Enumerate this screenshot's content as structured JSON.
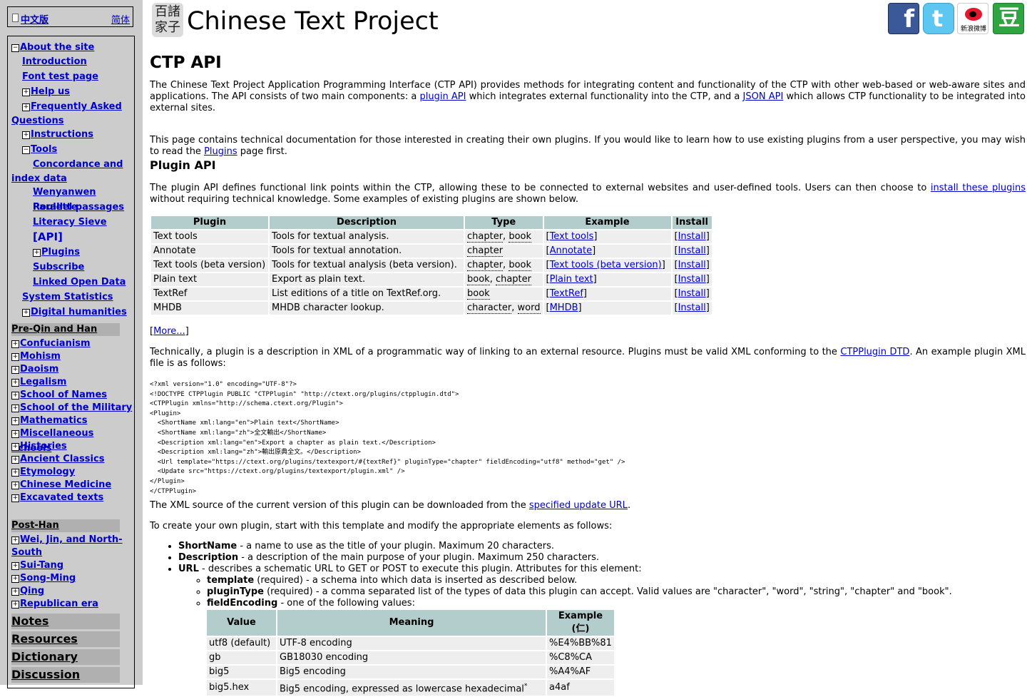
{
  "sidebar": {
    "lang_zh": "中文版",
    "lang_simp": "简体",
    "nav": [
      {
        "label": "About the site",
        "toggle": "−"
      },
      {
        "label": "Introduction"
      },
      {
        "label": "Font test page"
      },
      {
        "label": "Help us",
        "toggle": "+"
      },
      {
        "label": "Frequently Asked Questions",
        "toggle": "+",
        "line1": "Frequently Asked",
        "line2": "Questions"
      },
      {
        "label": "Instructions",
        "toggle": "+"
      },
      {
        "label": "Tools",
        "toggle": "−"
      },
      {
        "label": "Concordance and index data",
        "line1": "Concordance and",
        "line2": "index data"
      },
      {
        "label": "Wenyanwen Roulette"
      },
      {
        "label": "Parallel passages"
      },
      {
        "label": "Literacy Sieve"
      },
      {
        "label": "[API]"
      },
      {
        "label": "Plugins",
        "toggle": "+"
      },
      {
        "label": "Subscribe"
      },
      {
        "label": "Linked Open Data"
      },
      {
        "label": "System Statistics"
      },
      {
        "label": "Digital humanities",
        "toggle": "+"
      }
    ],
    "preqin_title": "Pre-Qin and Han",
    "preqin": [
      "Confucianism",
      "Mohism",
      "Daoism",
      "Legalism",
      "School of Names",
      "School of the Military",
      "Mathematics",
      "Miscellaneous Schools",
      "Histories",
      "Ancient Classics",
      "Etymology",
      "Chinese Medicine",
      "Excavated texts"
    ],
    "posthan_title": "Post-Han",
    "posthan": [
      {
        "label": "Wei, Jin, and North-South",
        "line1": "Wei, Jin, and North-",
        "line2": "South"
      },
      {
        "label": "Sui-Tang"
      },
      {
        "label": "Song-Ming"
      },
      {
        "label": "Qing"
      },
      {
        "label": "Republican era"
      }
    ],
    "big_links": [
      "Notes",
      "Resources",
      "Dictionary",
      "Discussion"
    ]
  },
  "header": {
    "logo_chars": [
      "百諸",
      "家子"
    ],
    "title": "Chinese Text Project",
    "social": {
      "facebook": "f",
      "twitter": "t",
      "weibo_caption": "新浪微博",
      "douban": "豆"
    }
  },
  "main": {
    "title": "CTP API",
    "intro1_a": "The Chinese Text Project Application Programming Interface (CTP API) provides methods for integrating content and functionality of the CTP with other web-based or web-aware sites and applications. The API consists of two main components: a ",
    "intro1_link1": "plugin API",
    "intro1_b": " which integrates external functionality into the CTP, and a ",
    "intro1_link2": "JSON API",
    "intro1_c": " which allows CTP functionality to be integrated into external sites.",
    "intro2_a": "This page contains technical documentation for those interested in creating their own plugins. If you would like to learn how to use existing plugins from a user perspective, you may wish to read the ",
    "intro2_link": "Plugins",
    "intro2_b": " page first.",
    "plugin_heading": "Plugin API",
    "plugin_intro_a": "The plugin API defines functional link points within the CTP, allowing these to be connected to external websites and user-defined tools. Users can then choose to ",
    "plugin_intro_link": "install these plugins",
    "plugin_intro_b": " without requiring technical knowledge. Some examples of existing plugins are shown below.",
    "plugin_table": {
      "headers": [
        "Plugin",
        "Description",
        "Type",
        "Example",
        "Install"
      ],
      "rows": [
        {
          "plugin": "Text tools",
          "description": "Tools for textual analysis.",
          "types": [
            "chapter",
            "book"
          ],
          "example": "Text tools",
          "install": "Install"
        },
        {
          "plugin": "Annotate",
          "description": "Tools for textual annotation.",
          "types": [
            "chapter"
          ],
          "example": "Annotate",
          "install": "Install"
        },
        {
          "plugin": "Text tools (beta version)",
          "description": "Tools for textual analysis (beta version).",
          "types": [
            "chapter",
            "book"
          ],
          "example": "Text tools (beta version)",
          "install": "Install"
        },
        {
          "plugin": "Plain text",
          "description": "Export as plain text.",
          "types": [
            "book",
            "chapter"
          ],
          "example": "Plain text",
          "install": "Install"
        },
        {
          "plugin": "TextRef",
          "description": "List editions of a title on TextRef.org.",
          "types": [
            "book"
          ],
          "example": "TextRef",
          "install": "Install"
        },
        {
          "plugin": "MHDB",
          "description": "MHDB character lookup.",
          "types": [
            "character",
            "word"
          ],
          "example": "MHDB",
          "install": "Install"
        }
      ]
    },
    "more_link": "More...",
    "tech_a": "Technically, a plugin is a description in XML of a programmatic way of linking to an external resource. Plugins must be valid XML conforming to the ",
    "tech_link": "CTPPlugin DTD",
    "tech_b": ". An example plugin XML file is as follows:",
    "xml": "<?xml version=\"1.0\" encoding=\"UTF-8\"?>\n<!DOCTYPE CTPPlugin PUBLIC \"CTPPlugin\" \"http://ctext.org/plugins/ctpplugin.dtd\">\n<CTPPlugin xmlns=\"http://schema.ctext.org/Plugin\">\n<Plugin>\n  <ShortName xml:lang=\"en\">Plain text</ShortName>\n  <ShortName xml:lang=\"zh\">全文輸出</ShortName>\n  <Description xml:lang=\"en\">Export a chapter as plain text.</Description>\n  <Description xml:lang=\"zh\">輸出原典全文。</Description>\n  <Url template=\"https://ctext.org/plugins/textexport/#{textRef}\" pluginType=\"chapter\" fieldEncoding=\"utf8\" method=\"get\" />\n  <Update src=\"https://ctext.org/plugins/textexport/plugin.xml\" />\n</Plugin>\n</CTPPlugin>",
    "xml_source_a": "The XML source of the current version of this plugin can be downloaded from the ",
    "xml_source_link": "specified update URL",
    "xml_source_b": ".",
    "create_text": "To create your own plugin, start with this template and modify the appropriate elements as follows:",
    "fields": [
      {
        "name": "ShortName",
        "desc": " - a name to use as the title of your plugin. Maximum 20 characters."
      },
      {
        "name": "Description",
        "desc": " - a description of the main purpose of your plugin. Maximum 250 characters."
      },
      {
        "name": "URL",
        "desc": " - describes a schematic URL to GET or POST to execute this plugin. Attributes for this element:"
      }
    ],
    "url_attrs": [
      {
        "name": "template",
        "desc": " (required) - a schema into which data is inserted as described below."
      },
      {
        "name": "pluginType",
        "desc": " (required) - a comma separated list of the types of data this plugin can accept. Valid values are \"character\", \"word\", \"string\", \"chapter\" and \"book\"."
      },
      {
        "name": "fieldEncoding",
        "desc": " - one of the following values:"
      }
    ],
    "encoding_table": {
      "headers": [
        "Value",
        "Meaning",
        "Example (仁)"
      ],
      "rows": [
        [
          "utf8 (default)",
          "UTF-8 encoding",
          "%E4%BB%81"
        ],
        [
          "gb",
          "GB18030 encoding",
          "%C8%CA"
        ],
        [
          "big5",
          "Big5 encoding",
          "%A4%AF"
        ],
        [
          "big5.hex",
          "Big5 encoding, expressed as lowercase hexadecimal*",
          "a4af"
        ]
      ]
    }
  }
}
